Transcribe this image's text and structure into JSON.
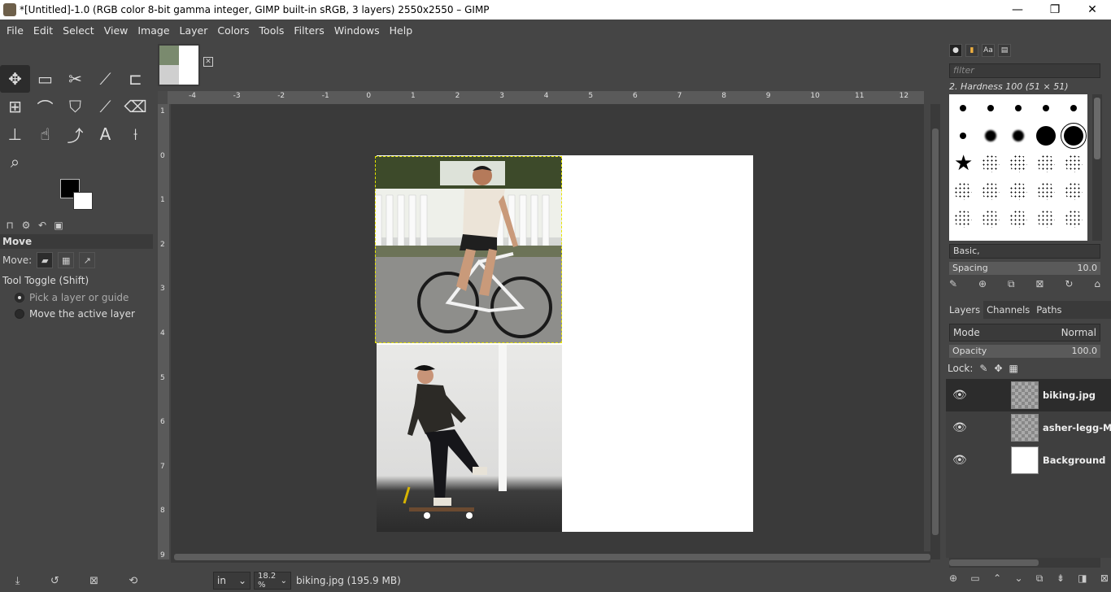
{
  "window": {
    "title": "*[Untitled]-1.0 (RGB color 8-bit gamma integer, GIMP built-in sRGB, 3 layers) 2550x2550 – GIMP",
    "controls": [
      "—",
      "❐",
      "✕"
    ]
  },
  "menu": [
    "File",
    "Edit",
    "Select",
    "View",
    "Image",
    "Layer",
    "Colors",
    "Tools",
    "Filters",
    "Windows",
    "Help"
  ],
  "tools": [
    {
      "name": "move-tool",
      "glyph": "✥",
      "active": true
    },
    {
      "name": "rect-select-tool",
      "glyph": "▭"
    },
    {
      "name": "scissors-select-tool",
      "glyph": "✂"
    },
    {
      "name": "fuzzy-select-tool",
      "glyph": "⟋"
    },
    {
      "name": "crop-tool",
      "glyph": "⊏"
    },
    {
      "name": "unified-transform-tool",
      "glyph": "⊞"
    },
    {
      "name": "warp-transform-tool",
      "glyph": "⌒"
    },
    {
      "name": "bucket-fill-tool",
      "glyph": "⛉"
    },
    {
      "name": "paintbrush-tool",
      "glyph": "⟋"
    },
    {
      "name": "eraser-tool",
      "glyph": "⌫"
    },
    {
      "name": "clone-tool",
      "glyph": "⊥"
    },
    {
      "name": "smudge-tool",
      "glyph": "☝"
    },
    {
      "name": "paths-tool",
      "glyph": "⤴"
    },
    {
      "name": "text-tool",
      "glyph": "A"
    },
    {
      "name": "color-picker-tool",
      "glyph": "⟊"
    },
    {
      "name": "zoom-tool",
      "glyph": "⌕"
    }
  ],
  "colors": {
    "foreground": "#000000",
    "background": "#ffffff",
    "selection": "#e8e500"
  },
  "tool_options": {
    "title": "Move",
    "move_label": "Move:",
    "toggle_label": "Tool Toggle  (Shift)",
    "radio_pick": "Pick a layer or guide",
    "radio_move": "Move the active layer"
  },
  "ruler_top": [
    "-4",
    "-3",
    "-2",
    "-1",
    "0",
    "1",
    "2",
    "3",
    "4",
    "5",
    "6",
    "7",
    "8",
    "9",
    "10",
    "11",
    "12"
  ],
  "ruler_left": [
    "1",
    "0",
    "1",
    "2",
    "3",
    "4",
    "5",
    "6",
    "7",
    "8",
    "9"
  ],
  "status": {
    "unit": "in",
    "zoom": "18.2 %",
    "text": "biking.jpg (195.9 MB)"
  },
  "brushes": {
    "filter_placeholder": "filter",
    "current": "2. Hardness 100 (51 × 51)",
    "preset": "Basic,",
    "spacing_label": "Spacing",
    "spacing_value": "10.0"
  },
  "layers_panel": {
    "tabs": [
      "Layers",
      "Channels",
      "Paths"
    ],
    "mode_label": "Mode",
    "mode_value": "Normal",
    "opacity_label": "Opacity",
    "opacity_value": "100.0",
    "lock_label": "Lock:",
    "layers": [
      {
        "name": "biking.jpg",
        "active": true
      },
      {
        "name": "asher-legg-Mi",
        "active": false
      },
      {
        "name": "Background",
        "active": false
      }
    ]
  }
}
